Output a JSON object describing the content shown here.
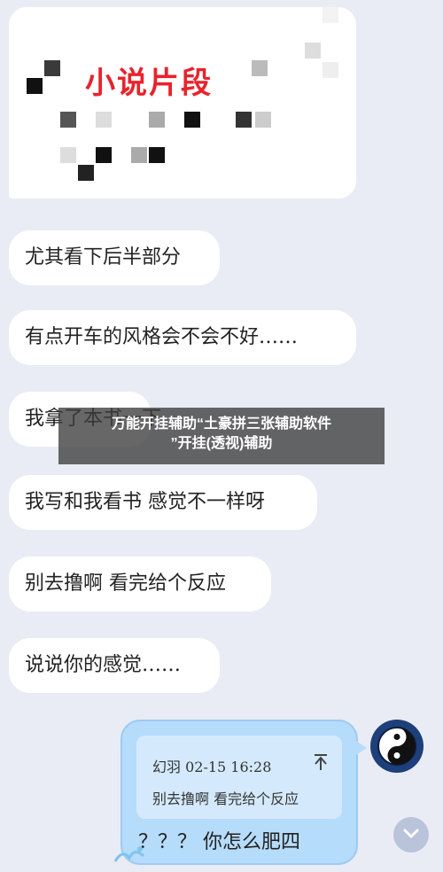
{
  "card": {
    "title": "小说片段"
  },
  "messages": [
    {
      "text": "尤其看下后半部分"
    },
    {
      "text": "有点开车的风格会不会不好……"
    },
    {
      "text": "我拿了本书一下"
    },
    {
      "text": "我写和我看书 感觉不一样呀"
    },
    {
      "text": "别去撸啊 看完给个反应"
    },
    {
      "text": "说说你的感觉……"
    }
  ],
  "overlay": {
    "line1": "万能开挂辅助“土豪拼三张辅助软件",
    "line2": "”开挂(透视)辅助"
  },
  "sent": {
    "quote_meta": "幻羽 02-15 16:28",
    "quote_text": "别去撸啊 看完给个反应",
    "text": "？？？ 你怎么肥四"
  },
  "icons": {
    "avatar": "yin-yang-icon",
    "scroll": "chevron-down-icon",
    "quote_arrow": "up-arrow-icon"
  },
  "colors": {
    "background": "#e9ecf4",
    "title_red": "#e8232c",
    "sent_bubble": "#b6dcfb"
  }
}
